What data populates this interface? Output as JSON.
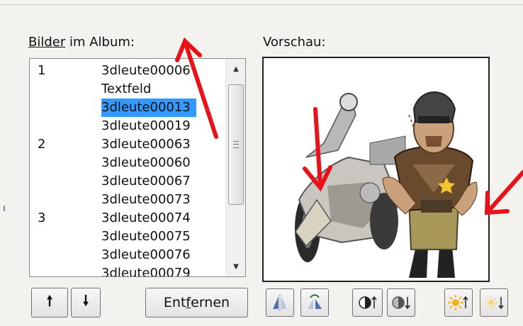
{
  "labels": {
    "album_prefix": "Bilder",
    "album_suffix": " im Album:",
    "preview": "Vorschau:"
  },
  "album_list": {
    "rows": [
      {
        "num": "1",
        "name": "3dleute00006"
      },
      {
        "num": "",
        "name": "Textfeld"
      },
      {
        "num": "",
        "name": "3dleute00013",
        "selected": true
      },
      {
        "num": "",
        "name": "3dleute00019"
      },
      {
        "num": "2",
        "name": "3dleute00063"
      },
      {
        "num": "",
        "name": "3dleute00060"
      },
      {
        "num": "",
        "name": "3dleute00067"
      },
      {
        "num": "",
        "name": "3dleute00073"
      },
      {
        "num": "3",
        "name": "3dleute00074"
      },
      {
        "num": "",
        "name": "3dleute00075"
      },
      {
        "num": "",
        "name": "3dleute00076"
      },
      {
        "num": "",
        "name": "3dleute00079"
      }
    ]
  },
  "buttons": {
    "move_up_icon": "up-arrow-icon",
    "move_down_icon": "down-arrow-icon",
    "remove_prefix": "Ent",
    "remove_underlined": "f",
    "remove_suffix": "ernen",
    "flip_horizontal_icon": "flip-horizontal-icon",
    "flip_vertical_icon": "flip-vertical-icon",
    "contrast_up_icon": "contrast-up-icon",
    "contrast_down_icon": "contrast-down-icon",
    "brightness_up_icon": "brightness-up-icon",
    "brightness_down_icon": "brightness-down-icon"
  },
  "colors": {
    "selection": "#3399ff",
    "annotation_red": "#e8121a"
  }
}
